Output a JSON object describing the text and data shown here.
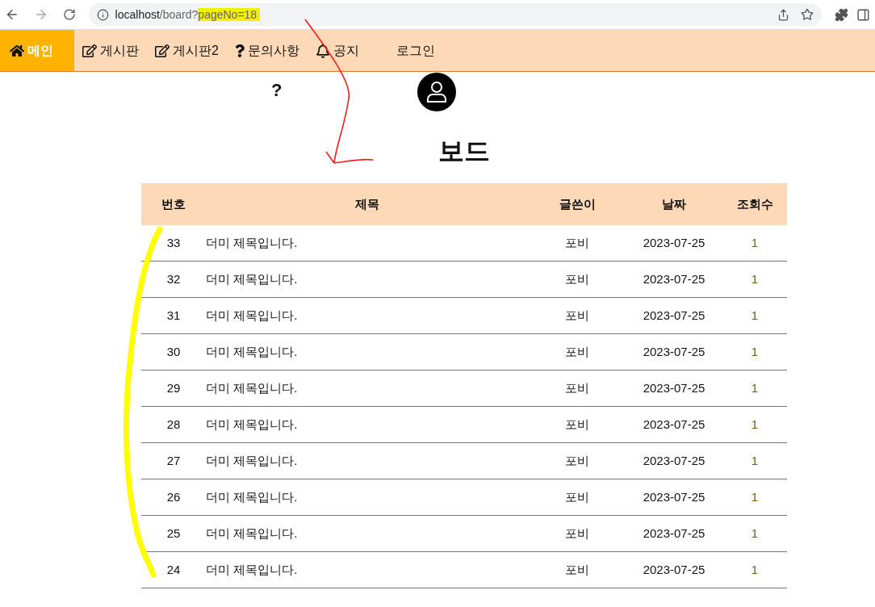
{
  "browser": {
    "url_host": "localhost",
    "url_path": "/board?",
    "url_query": "pageNo=18"
  },
  "nav": {
    "items": [
      {
        "label": "메인",
        "kind": "home",
        "selected": true
      },
      {
        "label": "게시판",
        "kind": "edit",
        "selected": false
      },
      {
        "label": "게시판2",
        "kind": "edit",
        "selected": false
      },
      {
        "label": "문의사항",
        "kind": "question",
        "selected": false
      },
      {
        "label": "공지",
        "kind": "bell",
        "selected": false
      }
    ],
    "login": "로그인"
  },
  "help_mark": "?",
  "title": "보드",
  "table": {
    "columns": [
      "번호",
      "제목",
      "글쓴이",
      "날짜",
      "조회수"
    ],
    "rows": [
      [
        "33",
        "더미 제목입니다.",
        "포비",
        "2023-07-25",
        "1"
      ],
      [
        "32",
        "더미 제목입니다.",
        "포비",
        "2023-07-25",
        "1"
      ],
      [
        "31",
        "더미 제목입니다.",
        "포비",
        "2023-07-25",
        "1"
      ],
      [
        "30",
        "더미 제목입니다.",
        "포비",
        "2023-07-25",
        "1"
      ],
      [
        "29",
        "더미 제목입니다.",
        "포비",
        "2023-07-25",
        "1"
      ],
      [
        "28",
        "더미 제목입니다.",
        "포비",
        "2023-07-25",
        "1"
      ],
      [
        "27",
        "더미 제목입니다.",
        "포비",
        "2023-07-25",
        "1"
      ],
      [
        "26",
        "더미 제목입니다.",
        "포비",
        "2023-07-25",
        "1"
      ],
      [
        "25",
        "더미 제목입니다.",
        "포비",
        "2023-07-25",
        "1"
      ],
      [
        "24",
        "더미 제목입니다.",
        "포비",
        "2023-07-25",
        "1"
      ]
    ]
  }
}
